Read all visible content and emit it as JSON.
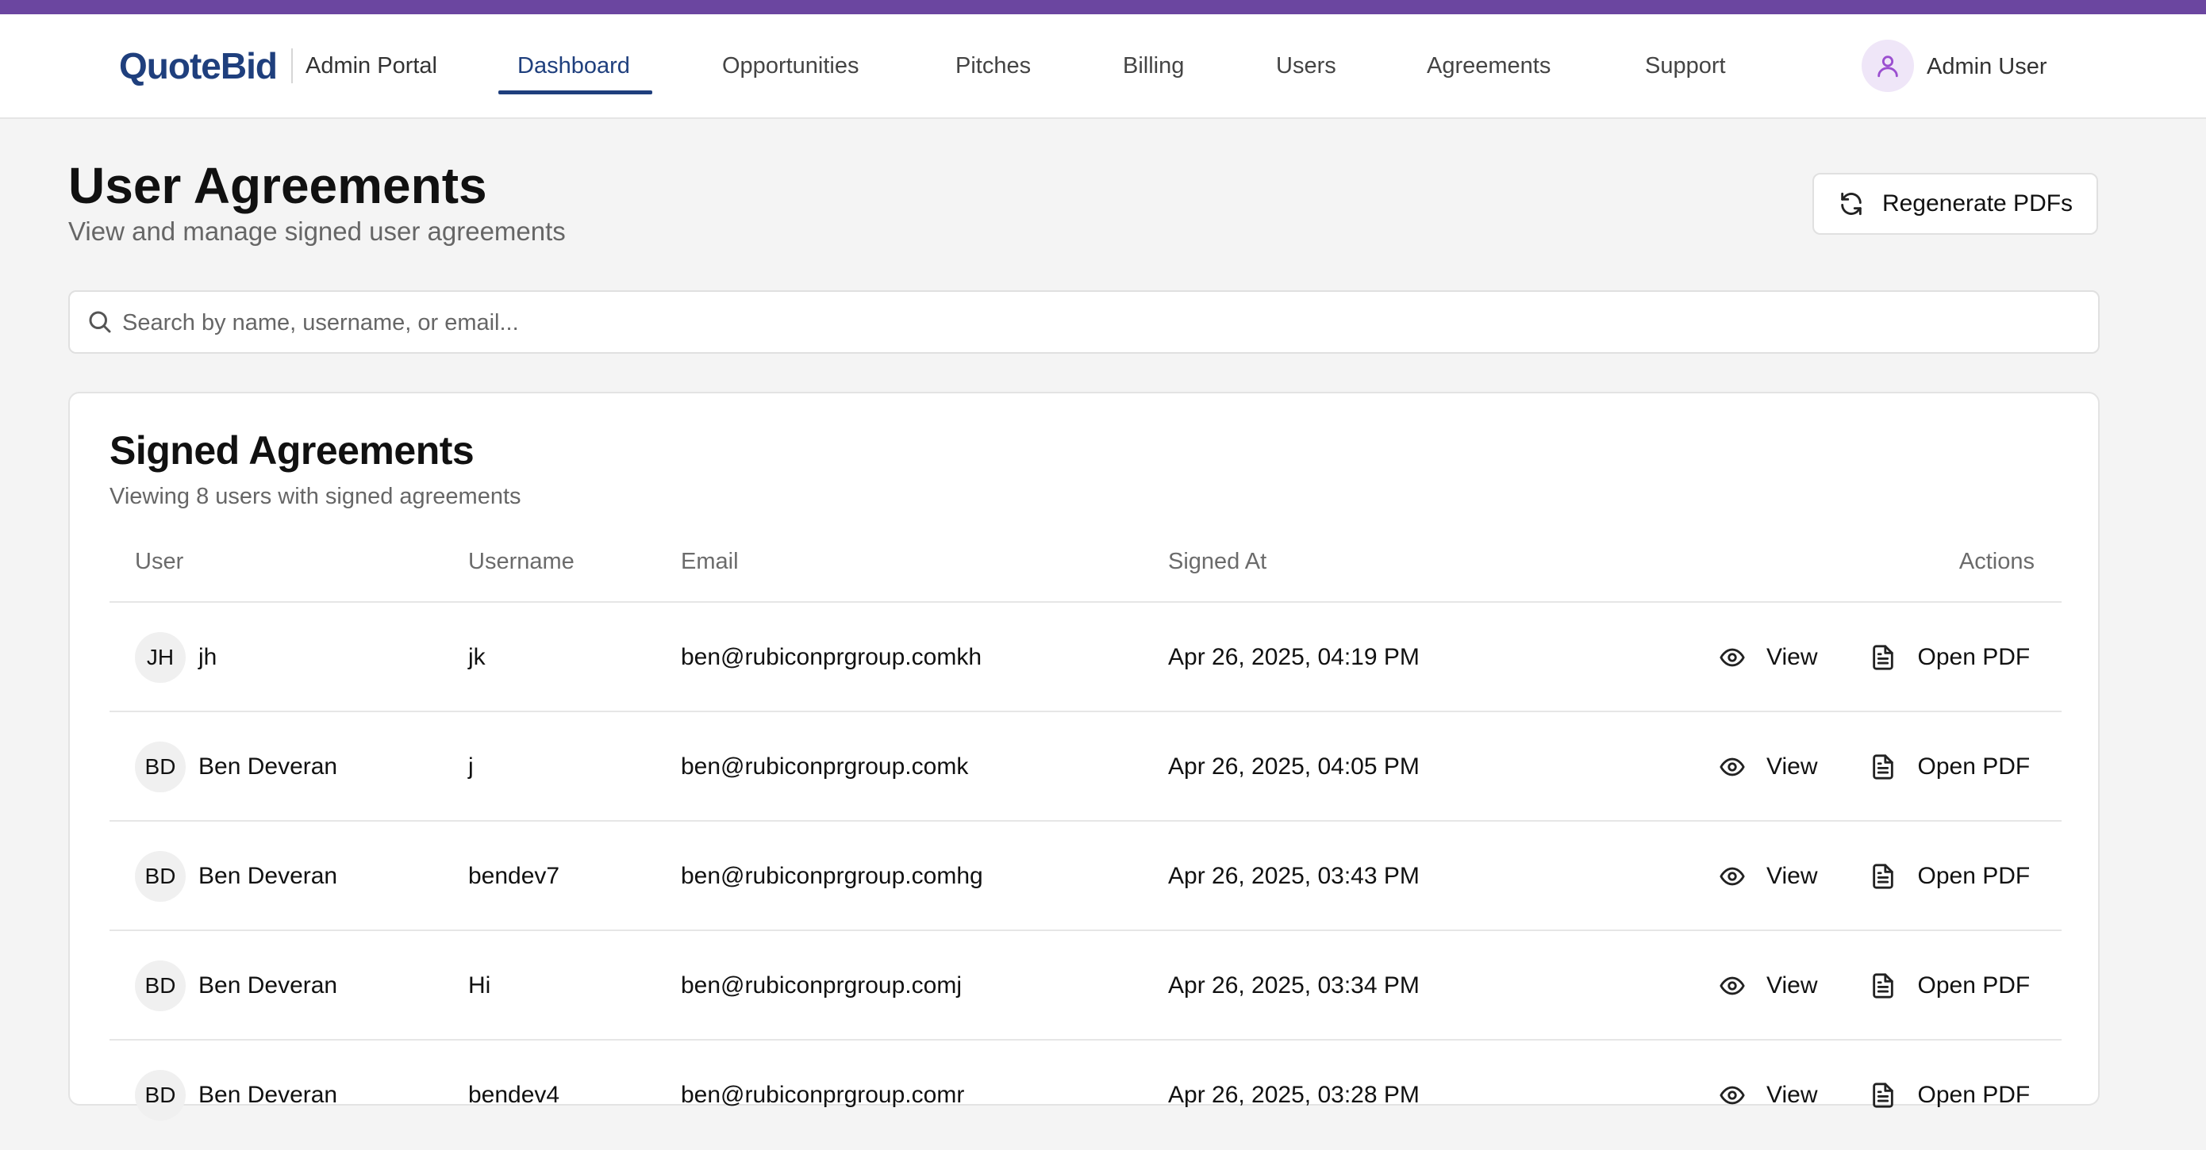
{
  "app": {
    "brand": "QuoteBid",
    "portal": "Admin Portal",
    "user_name": "Admin User"
  },
  "nav": {
    "items": [
      {
        "label": "Dashboard",
        "active": true
      },
      {
        "label": "Opportunities",
        "active": false
      },
      {
        "label": "Pitches",
        "active": false
      },
      {
        "label": "Billing",
        "active": false
      },
      {
        "label": "Users",
        "active": false
      },
      {
        "label": "Agreements",
        "active": false
      },
      {
        "label": "Support",
        "active": false
      }
    ]
  },
  "page": {
    "title": "User Agreements",
    "subtitle": "View and manage signed user agreements",
    "regenerate_label": "Regenerate PDFs"
  },
  "search": {
    "placeholder": "Search by name, username, or email...",
    "value": ""
  },
  "card": {
    "title": "Signed Agreements",
    "subtitle": "Viewing 8 users with signed agreements"
  },
  "table": {
    "headers": {
      "user": "User",
      "username": "Username",
      "email": "Email",
      "signed_at": "Signed At",
      "actions": "Actions"
    },
    "view_label": "View",
    "pdf_label": "Open PDF",
    "rows": [
      {
        "initials": "JH",
        "name": "jh",
        "username": "jk",
        "email": "ben@rubiconprgroup.comkh",
        "signed_at": "Apr 26, 2025, 04:19 PM"
      },
      {
        "initials": "BD",
        "name": "Ben Deveran",
        "username": "j",
        "email": "ben@rubiconprgroup.comk",
        "signed_at": "Apr 26, 2025, 04:05 PM"
      },
      {
        "initials": "BD",
        "name": "Ben Deveran",
        "username": "bendev7",
        "email": "ben@rubiconprgroup.comhg",
        "signed_at": "Apr 26, 2025, 03:43 PM"
      },
      {
        "initials": "BD",
        "name": "Ben Deveran",
        "username": "Hi",
        "email": "ben@rubiconprgroup.comj",
        "signed_at": "Apr 26, 2025, 03:34 PM"
      },
      {
        "initials": "BD",
        "name": "Ben Deveran",
        "username": "bendev4",
        "email": "ben@rubiconprgroup.comr",
        "signed_at": "Apr 26, 2025, 03:28 PM"
      }
    ]
  },
  "colors": {
    "accent_bar": "#6b46a0",
    "brand": "#1f3f7d",
    "avatar_user": "#9b4fd0"
  },
  "icons": [
    "user-icon",
    "refresh-icon",
    "search-icon",
    "eye-icon",
    "file-icon"
  ]
}
